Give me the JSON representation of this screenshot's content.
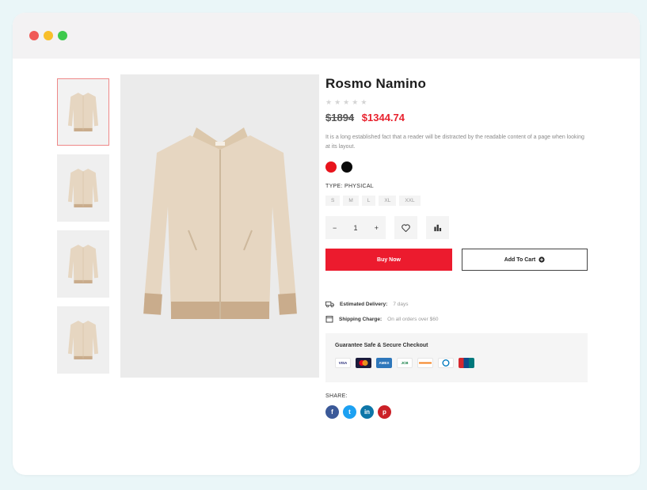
{
  "window": {
    "controls": [
      {
        "name": "close",
        "color": "#f05a57"
      },
      {
        "name": "minimize",
        "color": "#f8bf2b"
      },
      {
        "name": "maximize",
        "color": "#3ec94d"
      }
    ]
  },
  "product": {
    "title": "Rosmo Namino",
    "rating": 0,
    "rating_max": 5,
    "old_price": "$1894",
    "new_price": "$1344.74",
    "description": "It is a long established fact that a reader will be distracted by the readable content of a page when looking at its layout.",
    "colors": [
      "#e8141c",
      "#0a0a0a"
    ],
    "type_label": "TYPE: PHYSICAL",
    "sizes": [
      "S",
      "M",
      "L",
      "XL",
      "XXL"
    ],
    "quantity": "1",
    "minus": "−",
    "plus": "+",
    "buy_label": "Buy Now",
    "cart_label": "Add To Cart",
    "delivery_label": "Estimated Delivery:",
    "delivery_value": "7 days",
    "shipping_label": "Shipping Charge:",
    "shipping_value": "On all orders over $60",
    "checkout_title": "Guarantee Safe & Secure Checkout",
    "payment_cards": [
      {
        "name": "visa",
        "text": "VISA"
      },
      {
        "name": "mastercard",
        "text": ""
      },
      {
        "name": "amex",
        "text": "AMEX"
      },
      {
        "name": "jcb",
        "text": "JCB"
      },
      {
        "name": "discover",
        "text": ""
      },
      {
        "name": "diners",
        "text": ""
      },
      {
        "name": "unionpay",
        "text": ""
      }
    ],
    "share_label": "SHARE:",
    "socials": [
      {
        "name": "facebook",
        "glyph": "f",
        "color": "#3b5998"
      },
      {
        "name": "twitter",
        "glyph": "t",
        "color": "#1da1f2"
      },
      {
        "name": "linkedin",
        "glyph": "in",
        "color": "#0e76a8"
      },
      {
        "name": "pinterest",
        "glyph": "p",
        "color": "#cb2027"
      }
    ]
  },
  "colors": {
    "accent": "#ec1b2e",
    "jacket": "#e6d6c1",
    "jacket_shadow": "#d5c1a6",
    "cuff": "#c9ac8c"
  }
}
